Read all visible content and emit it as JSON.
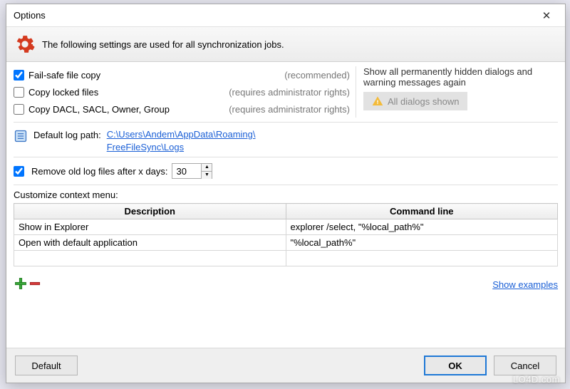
{
  "window": {
    "title": "Options",
    "close": "✕"
  },
  "banner": {
    "text": "The following settings are used for all synchronization jobs."
  },
  "checks": {
    "failsafe": {
      "label": "Fail-safe file copy",
      "hint": "(recommended)",
      "checked": true
    },
    "locked": {
      "label": "Copy locked files",
      "hint": "(requires administrator rights)",
      "checked": false
    },
    "dacl": {
      "label": "Copy DACL, SACL, Owner, Group",
      "hint": "(requires administrator rights)",
      "checked": false
    }
  },
  "dialogs": {
    "text": "Show all permanently hidden dialogs and warning messages again",
    "button": "All dialogs shown"
  },
  "log": {
    "label": "Default log path:",
    "link_line1": "C:\\Users\\Andem\\AppData\\Roaming\\",
    "link_line2": "FreeFileSync\\Logs"
  },
  "remove": {
    "label": "Remove old log files after x days:",
    "value": "30",
    "checked": true
  },
  "ctx": {
    "heading": "Customize context menu:",
    "col1": "Description",
    "col2": "Command line",
    "rows": [
      {
        "desc": "Show in Explorer",
        "cmd": "explorer /select, \"%local_path%\""
      },
      {
        "desc": "Open with default application",
        "cmd": "\"%local_path%\""
      },
      {
        "desc": "",
        "cmd": ""
      }
    ],
    "show_examples": "Show examples"
  },
  "footer": {
    "default": "Default",
    "ok": "OK",
    "cancel": "Cancel"
  },
  "watermark": "LO4D.com"
}
